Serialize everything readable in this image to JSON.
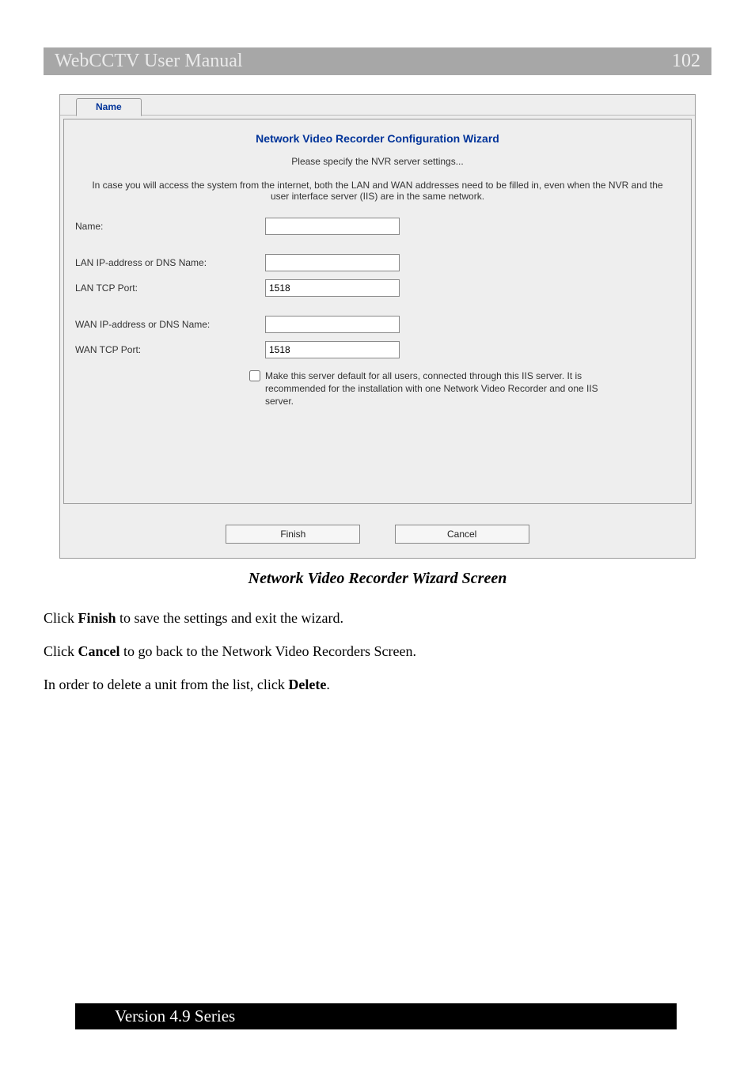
{
  "header": {
    "title": "WebCCTV User Manual",
    "page_number": "102"
  },
  "screenshot": {
    "tab_label": "Name",
    "wizard_title": "Network Video Recorder Configuration Wizard",
    "subtitle": "Please specify the NVR server settings...",
    "note": "In case you will access the system from the internet, both the LAN and WAN addresses need to be filled in, even when the NVR and the user interface server (IIS) are in the same network.",
    "fields": {
      "name": {
        "label": "Name:",
        "value": ""
      },
      "lan_ip": {
        "label": "LAN IP-address or DNS Name:",
        "value": ""
      },
      "lan_port": {
        "label": "LAN TCP Port:",
        "value": "1518"
      },
      "wan_ip": {
        "label": "WAN IP-address or DNS Name:",
        "value": ""
      },
      "wan_port": {
        "label": "WAN TCP Port:",
        "value": "1518"
      }
    },
    "checkbox": {
      "checked": false,
      "label": "Make this server default for all users, connected through this IIS server. It is recommended for the installation with one Network Video Recorder and one IIS server."
    },
    "buttons": {
      "finish": "Finish",
      "cancel": "Cancel"
    }
  },
  "caption": "Network Video Recorder Wizard Screen",
  "paragraphs": {
    "p1_a": "Click ",
    "p1_b": "Finish",
    "p1_c": " to save the settings and exit the wizard.",
    "p2_a": "Click ",
    "p2_b": "Cancel",
    "p2_c": " to go back to the Network Video Recorders Screen.",
    "p3_a": "In order to delete a unit from the list, click ",
    "p3_b": "Delete",
    "p3_c": "."
  },
  "footer": {
    "text": "Version 4.9 Series"
  }
}
